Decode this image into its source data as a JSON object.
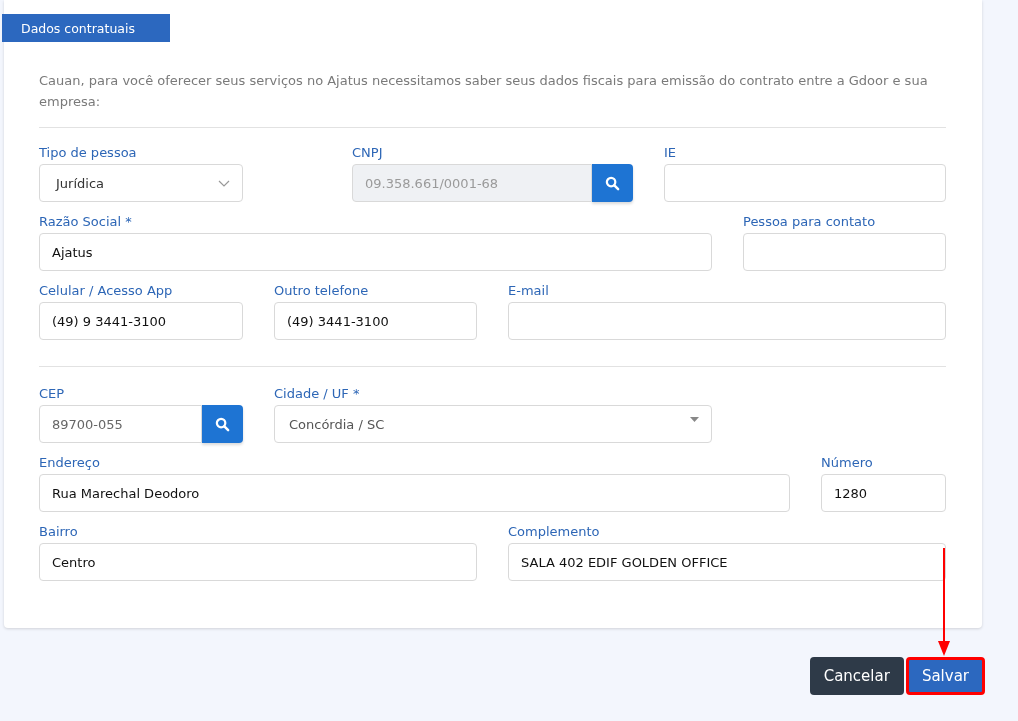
{
  "section_tab": "Dados contratuais",
  "intro": "Cauan, para você oferecer seus serviços no Ajatus necessitamos saber seus dados fiscais para emissão do contrato entre a Gdoor e sua empresa:",
  "field_rows": [
    [
      {
        "label": "Tipo de pessoa",
        "kind": "select",
        "value": "Jurídica"
      },
      {
        "label": "CNPJ",
        "kind": "search",
        "value": "09.358.661/0001-68",
        "disabled": true
      },
      {
        "label": "IE",
        "kind": "text"
      }
    ],
    [
      {
        "label": "Razão Social *",
        "kind": "text",
        "value": "Ajatus"
      },
      {
        "label": "Pessoa para contato",
        "kind": "text"
      }
    ],
    [
      {
        "label": "Celular / Acesso App",
        "kind": "text",
        "value": "(49) 9 3441-3100"
      },
      {
        "label": "Outro telefone",
        "kind": "text",
        "value": "(49) 3441-3100"
      },
      {
        "label": "E-mail",
        "kind": "text"
      }
    ],
    [
      {
        "label": "CEP",
        "kind": "search",
        "value": "89700-055",
        "disabled": false
      },
      {
        "label": "Cidade / UF *",
        "kind": "dropdown",
        "value": "Concórdia / SC"
      }
    ],
    [
      {
        "label": "Endereço",
        "kind": "text",
        "value": "Rua Marechal Deodoro"
      },
      {
        "label": "Número",
        "kind": "text",
        "value": "1280"
      }
    ],
    [
      {
        "label": "Bairro",
        "kind": "text",
        "value": "Centro"
      },
      {
        "label": "Complemento",
        "kind": "text",
        "value": "SALA 402 EDIF GOLDEN OFFICE"
      }
    ]
  ],
  "buttons": [
    {
      "label": "Cancelar",
      "kind": "secondary",
      "highlighted": false
    },
    {
      "label": "Salvar",
      "kind": "primary",
      "highlighted": true
    }
  ]
}
